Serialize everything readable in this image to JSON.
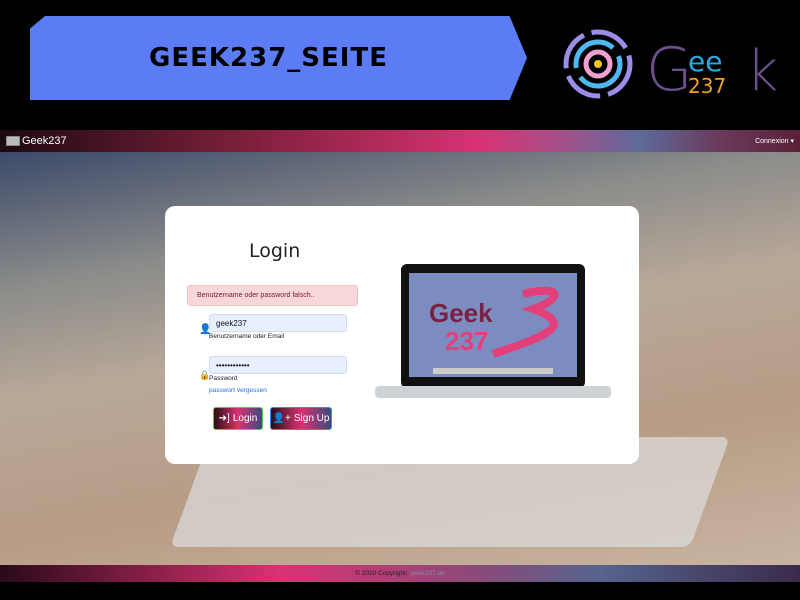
{
  "banner": {
    "title": "GEEK237_SEITE"
  },
  "logo": {
    "text_g": "G",
    "text_ee": "ee",
    "text_k": "k",
    "text_num": "237"
  },
  "navbar": {
    "brand": "Geek237",
    "menu": "Connexion ▾"
  },
  "login": {
    "title": "Login",
    "error": "Benutzername oder password falsch..",
    "username_value": "geek237",
    "username_label": "Benutzername oder Email",
    "password_value": "••••••••••••",
    "password_label": "Password",
    "forgot_link": "passwort vergessen",
    "login_button": "Login",
    "signup_button": "Sign Up"
  },
  "illustration": {
    "screen_text_1": "Geek",
    "screen_text_2": "237"
  },
  "footer": {
    "copyright": "© 2020 Copyright:",
    "link": "geek237.de"
  },
  "colors": {
    "banner": "#5b7cf5",
    "accent_pink": "#d93273",
    "alert_bg": "#f8d7da"
  }
}
